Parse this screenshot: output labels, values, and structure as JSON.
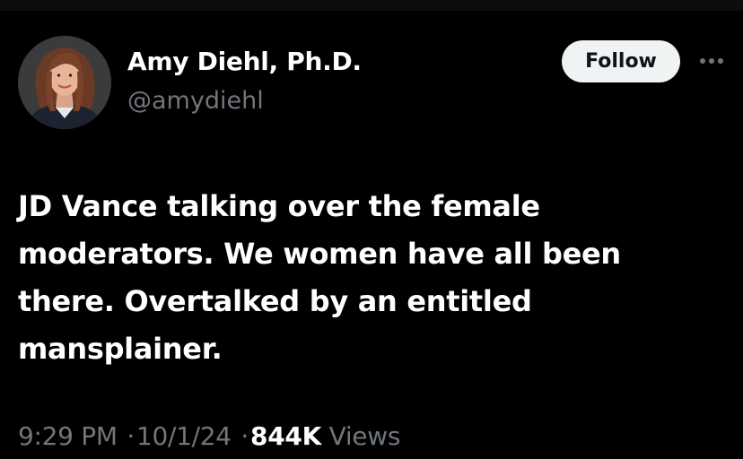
{
  "author": {
    "display_name": "Amy Diehl, Ph.D.",
    "handle": "@amydiehl"
  },
  "actions": {
    "follow_label": "Follow",
    "more_icon": "more-horizontal-icon"
  },
  "tweet": {
    "text": "JD Vance talking over the female moderators. We women have all been there. Overtalked by an entitled mansplainer."
  },
  "meta": {
    "time": "9:29 PM",
    "separator": "·",
    "date": "10/1/24",
    "views_count": "844K",
    "views_label": "Views"
  },
  "colors": {
    "background": "#000000",
    "primary_text": "#ffffff",
    "secondary_text": "#71767b",
    "follow_bg": "#eff3f4",
    "follow_text": "#0f1419"
  }
}
